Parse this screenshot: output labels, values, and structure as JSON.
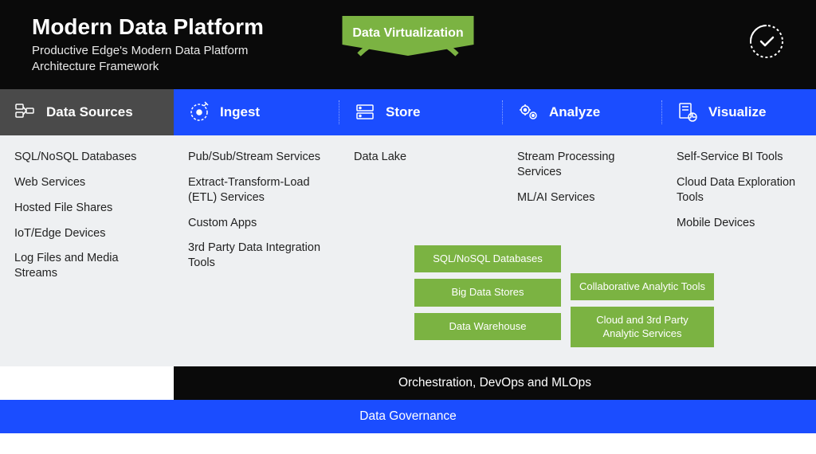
{
  "header": {
    "title": "Modern Data Platform",
    "subtitle": "Productive Edge's Modern Data Platform Architecture Framework",
    "virtualization_label": "Data Virtualization"
  },
  "tabs": {
    "sources": "Data Sources",
    "ingest": "Ingest",
    "store": "Store",
    "analyze": "Analyze",
    "visualize": "Visualize"
  },
  "columns": {
    "sources": [
      "SQL/NoSQL Databases",
      "Web Services",
      "Hosted File Shares",
      "IoT/Edge Devices",
      "Log Files and Media Streams"
    ],
    "ingest": [
      "Pub/Sub/Stream Services",
      "Extract-Transform-Load (ETL) Services",
      "Custom Apps",
      "3rd Party Data Integration Tools"
    ],
    "store": [
      "Data Lake"
    ],
    "analyze": [
      "Stream Processing Services",
      "ML/AI Services"
    ],
    "visualize": [
      "Self-Service BI Tools",
      "Cloud Data Exploration Tools",
      "Mobile Devices"
    ]
  },
  "green_boxes": {
    "left": [
      "SQL/NoSQL Databases",
      "Big Data Stores",
      "Data Warehouse"
    ],
    "right": [
      "Collaborative Analytic Tools",
      "Cloud and 3rd Party Analytic Services"
    ]
  },
  "footer": {
    "orchestration": "Orchestration, DevOps and MLOps",
    "governance": "Data Governance"
  }
}
